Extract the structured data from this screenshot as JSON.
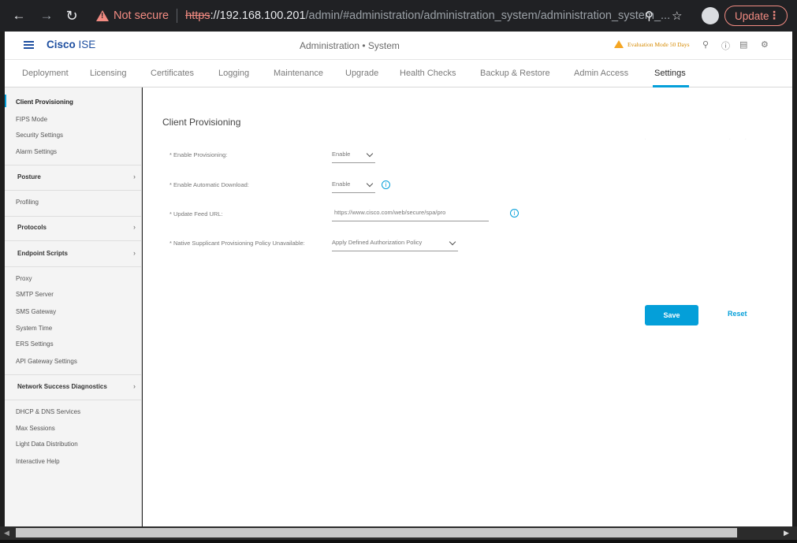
{
  "browser": {
    "security_label": "Not secure",
    "url_protocol": "https",
    "url_host": "://192.168.100.201",
    "url_path": "/admin/#administration/administration_system/administration_system_...",
    "update_label": "Update"
  },
  "header": {
    "brand_bold": "Cisco",
    "brand_light": " ISE",
    "title": "Administration • System",
    "evaluation": "Evaluation Mode 50 Days"
  },
  "tabs": [
    {
      "label": "Deployment"
    },
    {
      "label": "Licensing"
    },
    {
      "label": "Certificates"
    },
    {
      "label": "Logging"
    },
    {
      "label": "Maintenance"
    },
    {
      "label": "Upgrade"
    },
    {
      "label": "Health Checks"
    },
    {
      "label": "Backup & Restore"
    },
    {
      "label": "Admin Access"
    },
    {
      "label": "Settings"
    }
  ],
  "sidebar": {
    "items": [
      {
        "label": "Client Provisioning"
      },
      {
        "label": "FIPS Mode"
      },
      {
        "label": "Security Settings"
      },
      {
        "label": "Alarm Settings"
      },
      {
        "label": "Posture"
      },
      {
        "label": "Profiling"
      },
      {
        "label": "Protocols"
      },
      {
        "label": "Endpoint Scripts"
      },
      {
        "label": "Proxy"
      },
      {
        "label": "SMTP Server"
      },
      {
        "label": "SMS Gateway"
      },
      {
        "label": "System Time"
      },
      {
        "label": "ERS Settings"
      },
      {
        "label": "API Gateway Settings"
      },
      {
        "label": "Network Success Diagnostics"
      },
      {
        "label": "DHCP & DNS Services"
      },
      {
        "label": "Max Sessions"
      },
      {
        "label": "Light Data Distribution"
      },
      {
        "label": "Interactive Help"
      }
    ]
  },
  "main": {
    "title": "Client Provisioning",
    "fields": [
      {
        "label": "* Enable Provisioning:",
        "value": "Enable"
      },
      {
        "label": "* Enable Automatic Download:",
        "value": "Enable"
      },
      {
        "label": "* Update Feed URL:",
        "value": "https://www.cisco.com/web/secure/spa/pro"
      },
      {
        "label": "* Native Supplicant Provisioning Policy Unavailable:",
        "value": "Apply Defined Authorization Policy"
      }
    ],
    "save_label": "Save",
    "reset_label": "Reset"
  },
  "colors": {
    "accent": "#049fd9",
    "brand": "#1e4fa0",
    "warning": "#f5a623"
  }
}
